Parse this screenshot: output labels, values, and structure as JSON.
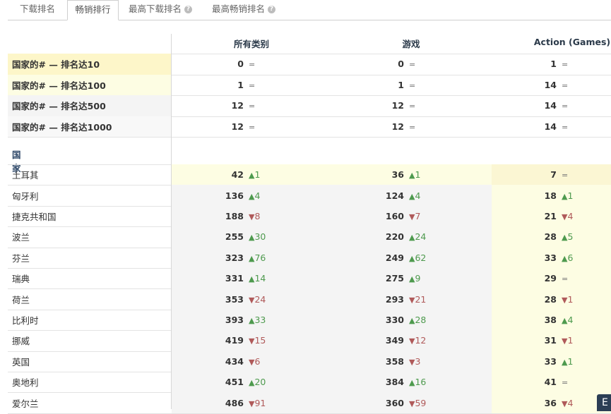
{
  "tabs": [
    {
      "label": "下载排名",
      "help": false,
      "active": false
    },
    {
      "label": "畅销排行",
      "help": false,
      "active": true
    },
    {
      "label": "最高下载排名",
      "help": true,
      "active": false
    },
    {
      "label": "最高畅销排名",
      "help": true,
      "active": false
    }
  ],
  "columns": [
    "所有类别",
    "游戏",
    "Action (Games)"
  ],
  "summary_rows": [
    {
      "label": "国家的# — 排名达10",
      "values": [
        {
          "v": "0",
          "d": "="
        },
        {
          "v": "0",
          "d": "="
        },
        {
          "v": "1",
          "d": "="
        }
      ]
    },
    {
      "label": "国家的# — 排名达100",
      "values": [
        {
          "v": "1",
          "d": "="
        },
        {
          "v": "1",
          "d": "="
        },
        {
          "v": "14",
          "d": "="
        }
      ]
    },
    {
      "label": "国家的# — 排名达500",
      "values": [
        {
          "v": "12",
          "d": "="
        },
        {
          "v": "12",
          "d": "="
        },
        {
          "v": "14",
          "d": "="
        }
      ]
    },
    {
      "label": "国家的# — 排名达1000",
      "values": [
        {
          "v": "12",
          "d": "="
        },
        {
          "v": "12",
          "d": "="
        },
        {
          "v": "14",
          "d": "="
        }
      ]
    }
  ],
  "section_title": "国家",
  "country_rows": [
    {
      "label": "土耳其",
      "values": [
        {
          "v": "42",
          "d": "▲",
          "n": "1"
        },
        {
          "v": "36",
          "d": "▲",
          "n": "1"
        },
        {
          "v": "7",
          "d": "=",
          "n": ""
        }
      ]
    },
    {
      "label": "匈牙利",
      "values": [
        {
          "v": "136",
          "d": "▲",
          "n": "4"
        },
        {
          "v": "124",
          "d": "▲",
          "n": "4"
        },
        {
          "v": "18",
          "d": "▲",
          "n": "1"
        }
      ]
    },
    {
      "label": "捷克共和国",
      "values": [
        {
          "v": "188",
          "d": "▼",
          "n": "8"
        },
        {
          "v": "160",
          "d": "▼",
          "n": "7"
        },
        {
          "v": "21",
          "d": "▼",
          "n": "4"
        }
      ]
    },
    {
      "label": "波兰",
      "values": [
        {
          "v": "255",
          "d": "▲",
          "n": "30"
        },
        {
          "v": "220",
          "d": "▲",
          "n": "24"
        },
        {
          "v": "28",
          "d": "▲",
          "n": "5"
        }
      ]
    },
    {
      "label": "芬兰",
      "values": [
        {
          "v": "323",
          "d": "▲",
          "n": "76"
        },
        {
          "v": "249",
          "d": "▲",
          "n": "62"
        },
        {
          "v": "33",
          "d": "▲",
          "n": "6"
        }
      ]
    },
    {
      "label": "瑞典",
      "values": [
        {
          "v": "331",
          "d": "▲",
          "n": "14"
        },
        {
          "v": "275",
          "d": "▲",
          "n": "9"
        },
        {
          "v": "29",
          "d": "=",
          "n": ""
        }
      ]
    },
    {
      "label": "荷兰",
      "values": [
        {
          "v": "353",
          "d": "▼",
          "n": "24"
        },
        {
          "v": "293",
          "d": "▼",
          "n": "21"
        },
        {
          "v": "28",
          "d": "▼",
          "n": "1"
        }
      ]
    },
    {
      "label": "比利时",
      "values": [
        {
          "v": "393",
          "d": "▲",
          "n": "33"
        },
        {
          "v": "330",
          "d": "▲",
          "n": "28"
        },
        {
          "v": "38",
          "d": "▲",
          "n": "4"
        }
      ]
    },
    {
      "label": "挪威",
      "values": [
        {
          "v": "419",
          "d": "▼",
          "n": "15"
        },
        {
          "v": "349",
          "d": "▼",
          "n": "12"
        },
        {
          "v": "31",
          "d": "▼",
          "n": "1"
        }
      ]
    },
    {
      "label": "英国",
      "values": [
        {
          "v": "434",
          "d": "▼",
          "n": "6"
        },
        {
          "v": "358",
          "d": "▼",
          "n": "3"
        },
        {
          "v": "33",
          "d": "▲",
          "n": "1"
        }
      ]
    },
    {
      "label": "奥地利",
      "values": [
        {
          "v": "451",
          "d": "▲",
          "n": "20"
        },
        {
          "v": "384",
          "d": "▲",
          "n": "16"
        },
        {
          "v": "41",
          "d": "=",
          "n": ""
        }
      ]
    },
    {
      "label": "爱尔兰",
      "values": [
        {
          "v": "486",
          "d": "▼",
          "n": "91"
        },
        {
          "v": "360",
          "d": "▼",
          "n": "59"
        },
        {
          "v": "36",
          "d": "▼",
          "n": "4"
        }
      ]
    }
  ],
  "corner_button_label": "E",
  "colors": {
    "yellow_strong": "#fdf6c9",
    "yellow_light": "#fdfde3",
    "gray_row": "#f4f4f4",
    "up": "#4e9a4e",
    "down": "#b05a5a"
  }
}
